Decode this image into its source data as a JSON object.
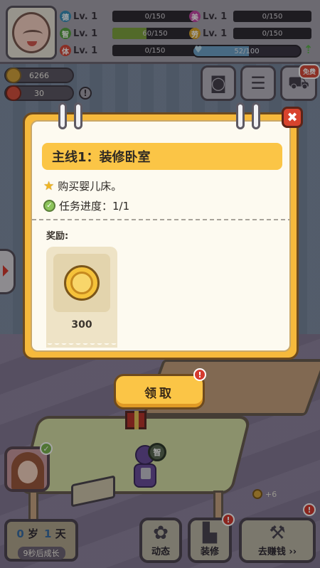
{
  "stats": [
    {
      "badge": "德",
      "badge_color": "#3a8fb8",
      "level": "Lv. 1",
      "value": "0/150",
      "progress": 0
    },
    {
      "badge": "智",
      "badge_color": "#58a243",
      "level": "Lv. 1",
      "value": "60/150",
      "progress": 0.4
    },
    {
      "badge": "体",
      "badge_color": "#d44a3c",
      "level": "Lv. 1",
      "value": "0/150",
      "progress": 0
    },
    {
      "badge": "美",
      "badge_color": "#c74aa8",
      "level": "Lv. 1",
      "value": "0/150",
      "progress": 0
    },
    {
      "badge": "劳",
      "badge_color": "#d9a52b",
      "level": "Lv. 1",
      "value": "0/150",
      "progress": 0
    }
  ],
  "exp": {
    "value": "52/100",
    "progress": 0.52
  },
  "resources": {
    "coins": "6266",
    "gems": "30"
  },
  "top_buttons": {
    "free_tag": "免费"
  },
  "modal": {
    "title": "主线1：装修卧室",
    "task": "购买婴儿床。",
    "progress_label": "任务进度：1/1",
    "reward_label": "奖励:",
    "reward_amount": "300",
    "claim_label": "领取"
  },
  "bottom": {
    "age_years": "0",
    "age_year_unit": "岁",
    "age_days": "1",
    "age_day_unit": "天",
    "grow_text": "9秒后成长",
    "coin_gain": "+6",
    "btn_dynamic": "动态",
    "btn_decorate": "装修",
    "btn_earn": "去赚钱 ››"
  },
  "icons": {
    "close": "close-icon",
    "star": "star-icon",
    "check": "check-icon",
    "coin": "coin-icon",
    "camera": "camera-icon",
    "clipboard": "clipboard-icon",
    "cart": "cart-icon"
  }
}
